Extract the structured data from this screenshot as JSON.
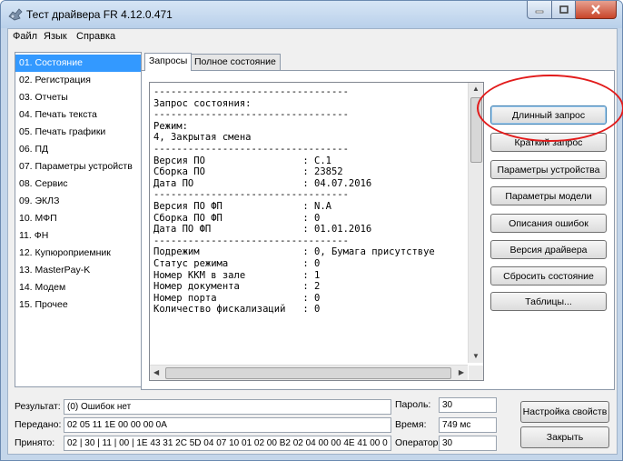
{
  "window": {
    "title": "Тест драйвера FR 4.12.0.471"
  },
  "menu": [
    "Файл",
    "Язык",
    "Справка"
  ],
  "sidebar": {
    "items": [
      {
        "label": "01. Состояние",
        "selected": true
      },
      {
        "label": "02. Регистрация"
      },
      {
        "label": "03. Отчеты"
      },
      {
        "label": "04. Печать текста"
      },
      {
        "label": "05. Печать графики"
      },
      {
        "label": "06. ПД"
      },
      {
        "label": "07. Параметры устройств"
      },
      {
        "label": "08. Сервис"
      },
      {
        "label": "09. ЭКЛЗ"
      },
      {
        "label": "10. МФП"
      },
      {
        "label": "11. ФН"
      },
      {
        "label": "12. Купюроприемник"
      },
      {
        "label": "13. MasterPay-K"
      },
      {
        "label": "14. Модем"
      },
      {
        "label": "15. Прочее"
      }
    ]
  },
  "tabs": [
    {
      "label": "Запросы",
      "active": true
    },
    {
      "label": "Полное состояние"
    }
  ],
  "console": {
    "text": "----------------------------------\nЗапрос состояния:\n----------------------------------\nРежим:\n4, Закрытая смена\n----------------------------------\nВерсия ПО                 : C.1\nСборка ПО                 : 23852\nДата ПО                   : 04.07.2016\n----------------------------------\nВерсия ПО ФП              : N.A\nСборка ПО ФП              : 0\nДата ПО ФП                : 01.01.2016\n----------------------------------\nПодрежим                  : 0, Бумага присутствуе\nСтатус режима             : 0\nНомер ККМ в зале          : 1\nНомер документа           : 2\nНомер порта               : 0\nКоличество фискализаций   : 0"
  },
  "buttons": [
    {
      "id": "long-request",
      "label": "Длинный запрос",
      "focused": true
    },
    {
      "id": "short-request",
      "label": "Краткий запрос"
    },
    {
      "id": "device-params",
      "label": "Параметры устройства"
    },
    {
      "id": "model-params",
      "label": "Параметры модели"
    },
    {
      "id": "error-descriptions",
      "label": "Описания ошибок"
    },
    {
      "id": "driver-version",
      "label": "Версия драйвера"
    },
    {
      "id": "reset-state",
      "label": "Сбросить состояние"
    },
    {
      "id": "tables",
      "label": "Таблицы..."
    }
  ],
  "bottom": {
    "result_label": "Результат:",
    "result_value": "(0) Ошибок нет",
    "sent_label": "Передано:",
    "sent_value": "02 05 11 1E 00 00 00 0A",
    "received_label": "Принято:",
    "received_value": "02 | 30 | 11 | 00 | 1E 43 31 2C 5D 04 07 10 01 02 00 B2 02 04 00 00 4E 41 00 0",
    "password_label": "Пароль:",
    "password_value": "30",
    "time_label": "Время:",
    "time_value": "749 мс",
    "operator_label": "Оператор:",
    "operator_value": "30",
    "settings_button": "Настройка свойств",
    "close_button": "Закрыть"
  },
  "colors": {
    "selection": "#3399ff",
    "annotation": "#e21b1b"
  }
}
